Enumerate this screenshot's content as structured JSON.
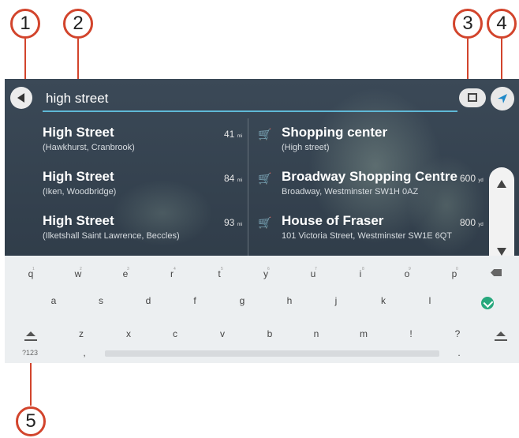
{
  "callouts": [
    "1",
    "2",
    "3",
    "4",
    "5"
  ],
  "search": {
    "value": "high street",
    "placeholder": ""
  },
  "results_left": [
    {
      "title": "High Street",
      "subtitle": "(Hawkhurst, Cranbrook)",
      "distance": "41",
      "unit": "mi"
    },
    {
      "title": "High Street",
      "subtitle": "(Iken, Woodbridge)",
      "distance": "84",
      "unit": "mi"
    },
    {
      "title": "High Street",
      "subtitle": "(Ilketshall Saint Lawrence, Beccles)",
      "distance": "93",
      "unit": "mi"
    }
  ],
  "results_right": [
    {
      "title": "Shopping center",
      "subtitle": "(High street)",
      "distance": "",
      "unit": "",
      "icon": "shopping-cart-icon"
    },
    {
      "title": "Broadway Shopping Centre",
      "subtitle": "Broadway, Westminster SW1H 0AZ",
      "distance": "600",
      "unit": "yd",
      "icon": "shopping-cart-icon"
    },
    {
      "title": "House of Fraser",
      "subtitle": "101 Victoria Street, Westminster SW1E 6QT",
      "distance": "800",
      "unit": "yd",
      "icon": "shopping-cart-icon"
    }
  ],
  "keyboard": {
    "row1": [
      "q",
      "w",
      "e",
      "r",
      "t",
      "y",
      "u",
      "i",
      "o",
      "p"
    ],
    "row1_hints": [
      "1",
      "2",
      "3",
      "4",
      "5",
      "6",
      "7",
      "8",
      "9",
      "0"
    ],
    "row2": [
      "a",
      "s",
      "d",
      "f",
      "g",
      "h",
      "j",
      "k",
      "l"
    ],
    "row3": [
      "z",
      "x",
      "c",
      "v",
      "b",
      "n",
      "m",
      "!",
      "?"
    ],
    "num_label": "?123",
    "comma": ",",
    "period": "."
  },
  "icons": {
    "back": "back-arrow-icon",
    "map": "map-view-icon",
    "nav": "navigation-arrow-icon",
    "scroll_up": "chevron-up-icon",
    "scroll_down": "chevron-down-icon",
    "backspace": "backspace-icon",
    "enter": "enter-icon",
    "shift": "shift-icon"
  },
  "colors": {
    "accent": "#d2442c",
    "underline": "#5fb8d6",
    "enter": "#27a87d"
  }
}
